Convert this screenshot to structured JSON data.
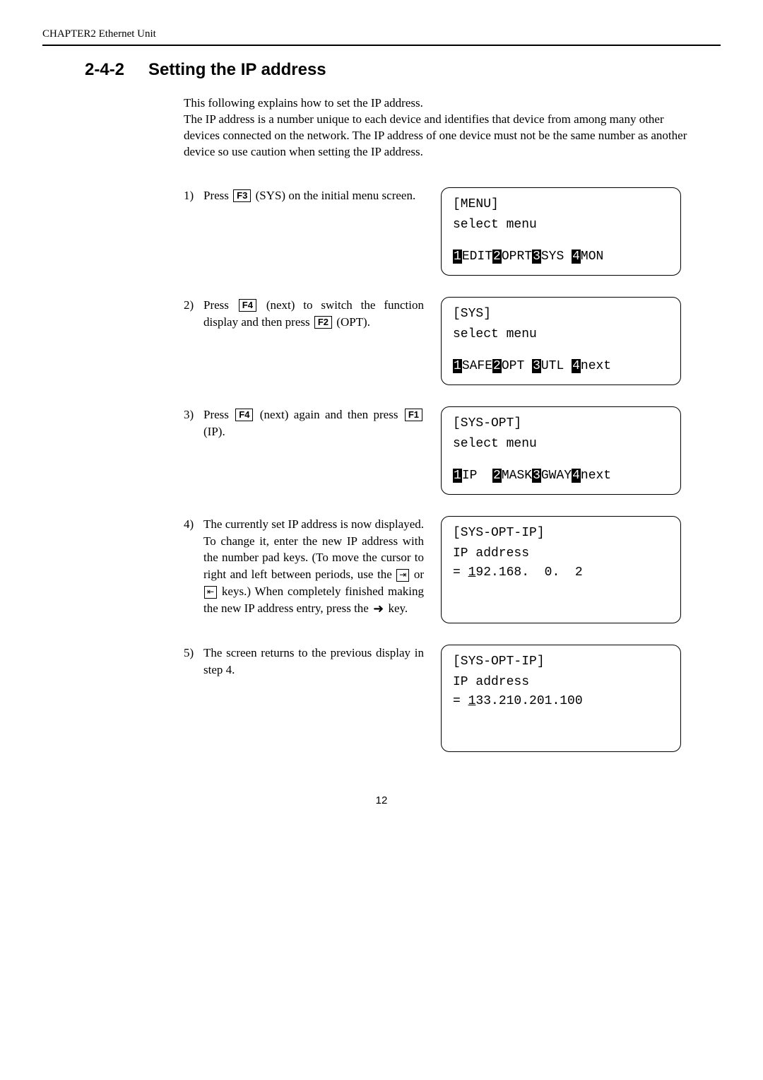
{
  "header": {
    "running": "CHAPTER2  Ethernet Unit"
  },
  "section": {
    "number": "2-4-2",
    "title": "Setting the IP address"
  },
  "intro": {
    "p1": "This following explains how to set the IP address.",
    "p2": "The IP address is a number unique to each device and identifies that device from among many other devices connected on the network. The IP address of one device must not be the same number as another device so use caution when setting the IP address."
  },
  "keys": {
    "F1": "F1",
    "F2": "F2",
    "F3": "F3",
    "F4": "F4"
  },
  "steps": {
    "s1": {
      "num": "1)",
      "pre": "Press ",
      "post": " (SYS) on the initial menu screen."
    },
    "s2": {
      "num": "2)",
      "pre": "Press ",
      "mid": " (next) to switch the function display and then press ",
      "post": " (OPT)."
    },
    "s3": {
      "num": "3)",
      "pre": "Press ",
      "mid": " (next) again and then press ",
      "post": " (IP)."
    },
    "s4": {
      "num": "4)",
      "t1": "The currently set IP address is now displayed. To change it, enter the new IP address with the number pad keys. (To move the cursor to right and left between periods, use the ",
      "or": " or ",
      "t2": " keys.) When completely finished making the new IP address entry, press the ",
      "t3": " key."
    },
    "s5": {
      "num": "5)",
      "text": "The screen returns to the previous display in step 4."
    }
  },
  "screens": {
    "menu": {
      "title": "[MENU]",
      "line1": "select menu",
      "sk": {
        "k1": "1",
        "l1": "EDIT",
        "k2": "2",
        "l2": "OPRT",
        "k3": "3",
        "l3": "SYS ",
        "k4": "4",
        "l4": "MON"
      }
    },
    "sys": {
      "title": "[SYS]",
      "line1": "select menu",
      "sk": {
        "k1": "1",
        "l1": "SAFE",
        "k2": "2",
        "l2": "OPT ",
        "k3": "3",
        "l3": "UTL ",
        "k4": "4",
        "l4": "next"
      }
    },
    "sysopt": {
      "title": "[SYS-OPT]",
      "line1": "select menu",
      "sk": {
        "k1": "1",
        "l1": "IP  ",
        "k2": "2",
        "l2": "MASK",
        "k3": "3",
        "l3": "GWAY",
        "k4": "4",
        "l4": "next"
      }
    },
    "ip1": {
      "title": "[SYS-OPT-IP]",
      "line1": "IP address",
      "eq": "= ",
      "first": "1",
      "rest": "92.168.  0.  2"
    },
    "ip2": {
      "title": "[SYS-OPT-IP]",
      "line1": "IP address",
      "eq": "= ",
      "first": "1",
      "rest": "33.210.201.100"
    }
  },
  "page": "12"
}
